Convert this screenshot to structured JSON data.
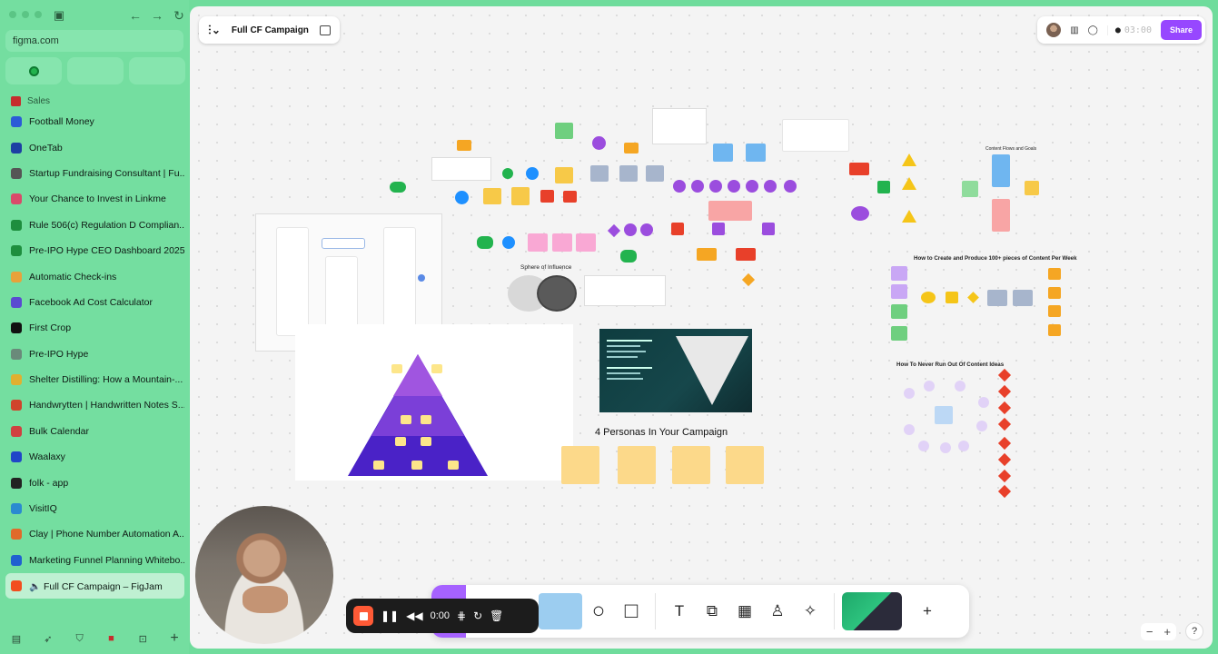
{
  "browser": {
    "url": "figma.com",
    "section_label": "Sales",
    "tabs": [
      {
        "title": "Football Money",
        "color": "#2b5bd7"
      },
      {
        "title": "OneTab",
        "color": "#1d3fa3"
      },
      {
        "title": "Startup Fundraising Consultant | Fu...",
        "color": "#555555"
      },
      {
        "title": "Your Chance to Invest in Linkme",
        "color": "#d94a6a"
      },
      {
        "title": "Rule 506(c) Regulation D Complian...",
        "color": "#1e8e3e"
      },
      {
        "title": "Pre-IPO Hype CEO Dashboard 2025",
        "color": "#1e8e3e"
      },
      {
        "title": "Automatic Check-ins",
        "color": "#e8a23a"
      },
      {
        "title": "Facebook Ad Cost Calculator",
        "color": "#5a4ad1"
      },
      {
        "title": "First Crop",
        "color": "#111111"
      },
      {
        "title": "Pre-IPO Hype",
        "color": "#6a8a7a"
      },
      {
        "title": "Shelter Distilling: How a Mountain-...",
        "color": "#e0b030"
      },
      {
        "title": "Handwrytten | Handwritten Notes S...",
        "color": "#d0442c"
      },
      {
        "title": "Bulk Calendar",
        "color": "#d04040"
      },
      {
        "title": "Waalaxy",
        "color": "#2046c8"
      },
      {
        "title": "folk - app",
        "color": "#222222"
      },
      {
        "title": "VisitIQ",
        "color": "#2a8ad0"
      },
      {
        "title": "Clay | Phone Number Automation A...",
        "color": "#e06a2a"
      },
      {
        "title": "Marketing Funnel Planning Whitebo...",
        "color": "#2060d0"
      },
      {
        "title": "🔈 Full CF Campaign – FigJam",
        "color": "#f24e1e"
      }
    ]
  },
  "figjam": {
    "file_name": "Full CF Campaign",
    "timer": "03:00",
    "share_label": "Share",
    "board_labels": {
      "sphere": "Sphere of Influence",
      "personas": "4 Personas In Your Campaign",
      "content_week": "How to Create and Produce 100+ pieces of Content Per Week",
      "never_run_out": "How To Never Run Out Of Content Ideas",
      "content_flows": "Content Flows and Goals"
    },
    "recorder_time": "0:00"
  },
  "colors": {
    "accent": "#9747ff",
    "sidebar": "#74dea0",
    "record": "#ff5a36"
  }
}
